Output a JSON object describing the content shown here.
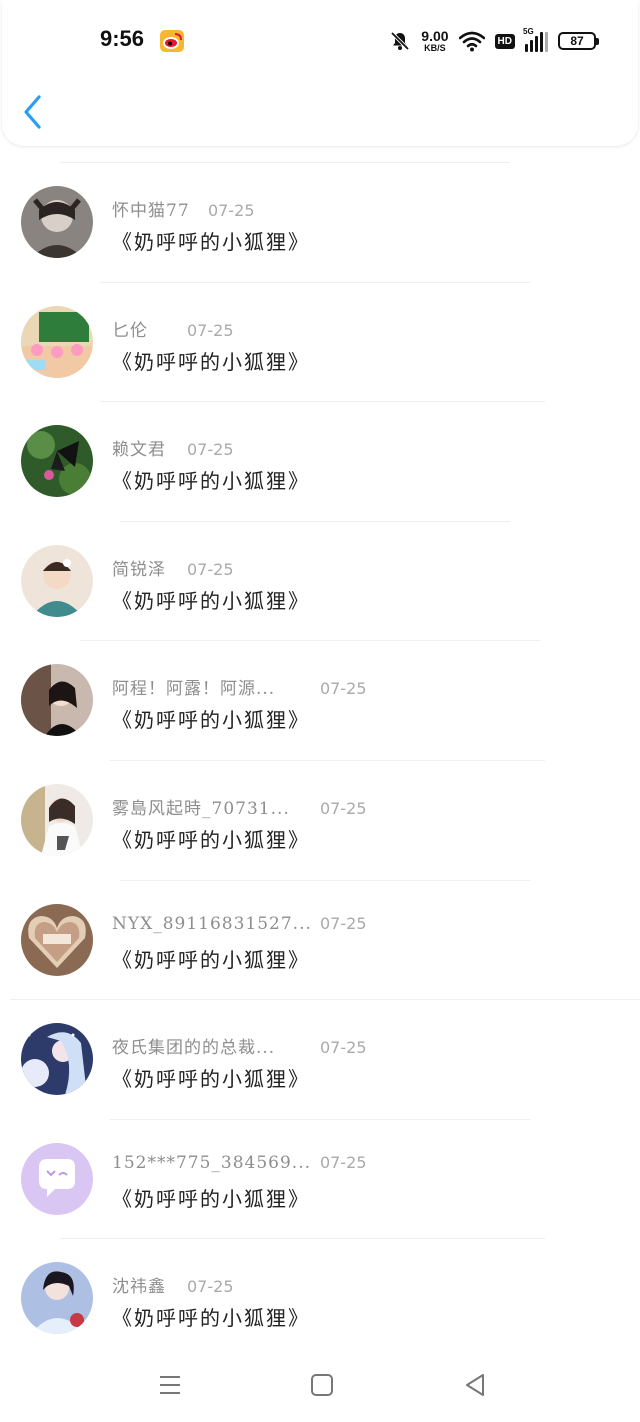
{
  "status_bar": {
    "time": "9:56",
    "speed_value": "9.00",
    "speed_unit": "KB/S",
    "hd_label": "HD",
    "network_label": "5G",
    "battery": "87"
  },
  "items": [
    {
      "name": "怀中猫77",
      "date": "07-25",
      "title": "《奶呼呼的小狐狸》"
    },
    {
      "name": "匕伦",
      "date": "07-25",
      "title": "《奶呼呼的小狐狸》"
    },
    {
      "name": "赖文君",
      "date": "07-25",
      "title": "《奶呼呼的小狐狸》"
    },
    {
      "name": "简锐泽",
      "date": "07-25",
      "title": "《奶呼呼的小狐狸》"
    },
    {
      "name": "阿程！阿露！阿源...",
      "date": "07-25",
      "title": "《奶呼呼的小狐狸》"
    },
    {
      "name": "雾島风起時_70731...",
      "date": "07-25",
      "title": "《奶呼呼的小狐狸》"
    },
    {
      "name": "NYX_89116831527...",
      "date": "07-25",
      "title": "《奶呼呼的小狐狸》"
    },
    {
      "name": "夜氏集团的的总裁...",
      "date": "07-25",
      "title": "《奶呼呼的小狐狸》"
    },
    {
      "name": "152***775_384569...",
      "date": "07-25",
      "title": "《奶呼呼的小狐狸》"
    },
    {
      "name": "沈祎鑫",
      "date": "07-25",
      "title": "《奶呼呼的小狐狸》"
    }
  ],
  "colors": {
    "accent": "#2a9df4",
    "name_text": "#8e8e8e",
    "date_text": "#aaaaaa",
    "title_text": "#222222"
  }
}
